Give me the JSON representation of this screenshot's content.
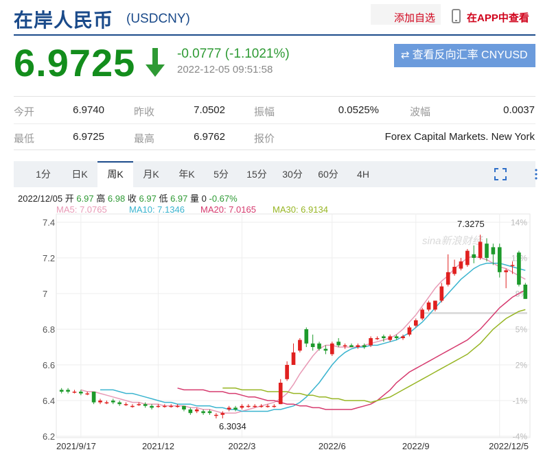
{
  "header": {
    "title": "在岸人民币",
    "code": "(USDCNY)",
    "add_favorite": "添加自选",
    "view_in_app": "在APP中查看"
  },
  "quote": {
    "price": "6.9725",
    "change": "-0.0777 (-1.1021%)",
    "timestamp": "2022-12-05 09:51:58",
    "direction": "down",
    "reverse_button": "查看反向汇率 CNYUSD"
  },
  "stats": [
    {
      "label": "今开",
      "value": "6.9740"
    },
    {
      "label": "昨收",
      "value": "7.0502"
    },
    {
      "label": "振幅",
      "value": "0.0525%"
    },
    {
      "label": "波幅",
      "value": "0.0037"
    },
    {
      "label": "最低",
      "value": "6.9725"
    },
    {
      "label": "最高",
      "value": "6.9762"
    },
    {
      "label": "报价",
      "value": "Forex Capital Markets. New York"
    }
  ],
  "tabs": [
    "1分",
    "日K",
    "周K",
    "月K",
    "年K",
    "5分",
    "15分",
    "30分",
    "60分",
    "4H"
  ],
  "active_tab": "周K",
  "bar_info": {
    "date": "2022/12/05",
    "open_label": "开",
    "open": "6.97",
    "high_label": "高",
    "high": "6.98",
    "close_label": "收",
    "close": "6.97",
    "low_label": "低",
    "low": "6.97",
    "volume_label": "量",
    "volume": "0",
    "change": "-0.67%"
  },
  "ma_legend": [
    {
      "text": "MA5: 7.0765",
      "color": "#e89ab6"
    },
    {
      "text": "MA10: 7.1346",
      "color": "#3ab4cf"
    },
    {
      "text": "MA20: 7.0165",
      "color": "#d63a6e"
    },
    {
      "text": "MA30: 6.9134",
      "color": "#97b523"
    }
  ],
  "chart_data": {
    "type": "candlestick",
    "ylim": [
      6.2,
      7.4
    ],
    "y_ticks": [
      "7.4",
      "7.2",
      "7",
      "6.8",
      "6.6",
      "6.4",
      "6.2"
    ],
    "right_ticks": [
      "14%",
      "11%",
      "8%",
      "5%",
      "2%",
      "-1%",
      "-4%"
    ],
    "x_labels": [
      "2021/9/17",
      "2021/12",
      "2022/3",
      "2022/6",
      "2022/9",
      "2022/12/5"
    ],
    "annotations": [
      {
        "text": "7.3275",
        "kind": "max"
      },
      {
        "text": "6.3034",
        "kind": "min"
      }
    ],
    "watermark": "sina新浪财经",
    "up_color": "#e0201f",
    "down_color": "#1d9a2b",
    "candles_ohlc": [
      [
        6.46,
        6.47,
        6.44,
        6.45
      ],
      [
        6.46,
        6.47,
        6.44,
        6.45
      ],
      [
        6.45,
        6.46,
        6.44,
        6.45
      ],
      [
        6.45,
        6.46,
        6.43,
        6.44
      ],
      [
        6.44,
        6.45,
        6.43,
        6.44
      ],
      [
        6.45,
        6.45,
        6.38,
        6.39
      ],
      [
        6.39,
        6.41,
        6.38,
        6.4
      ],
      [
        6.39,
        6.4,
        6.38,
        6.39
      ],
      [
        6.4,
        6.41,
        6.38,
        6.39
      ],
      [
        6.39,
        6.4,
        6.37,
        6.38
      ],
      [
        6.38,
        6.39,
        6.37,
        6.38
      ],
      [
        6.37,
        6.38,
        6.36,
        6.37
      ],
      [
        6.38,
        6.39,
        6.37,
        6.38
      ],
      [
        6.38,
        6.39,
        6.36,
        6.37
      ],
      [
        6.37,
        6.38,
        6.35,
        6.36
      ],
      [
        6.37,
        6.38,
        6.36,
        6.37
      ],
      [
        6.37,
        6.38,
        6.36,
        6.37
      ],
      [
        6.37,
        6.38,
        6.36,
        6.37
      ],
      [
        6.37,
        6.38,
        6.36,
        6.37
      ],
      [
        6.37,
        6.37,
        6.34,
        6.35
      ],
      [
        6.35,
        6.36,
        6.32,
        6.33
      ],
      [
        6.34,
        6.36,
        6.33,
        6.35
      ],
      [
        6.34,
        6.35,
        6.32,
        6.33
      ],
      [
        6.34,
        6.35,
        6.32,
        6.33
      ],
      [
        6.32,
        6.33,
        6.3,
        6.32
      ],
      [
        6.32,
        6.34,
        6.3,
        6.33
      ],
      [
        6.35,
        6.37,
        6.34,
        6.36
      ],
      [
        6.36,
        6.37,
        6.34,
        6.35
      ],
      [
        6.36,
        6.38,
        6.35,
        6.37
      ],
      [
        6.37,
        6.38,
        6.36,
        6.37
      ],
      [
        6.37,
        6.38,
        6.36,
        6.37
      ],
      [
        6.37,
        6.38,
        6.36,
        6.37
      ],
      [
        6.37,
        6.38,
        6.36,
        6.37
      ],
      [
        6.37,
        6.38,
        6.36,
        6.37
      ],
      [
        6.38,
        6.52,
        6.38,
        6.5
      ],
      [
        6.52,
        6.62,
        6.51,
        6.6
      ],
      [
        6.6,
        6.72,
        6.6,
        6.67
      ],
      [
        6.68,
        6.75,
        6.67,
        6.74
      ],
      [
        6.8,
        6.81,
        6.7,
        6.72
      ],
      [
        6.72,
        6.77,
        6.68,
        6.7
      ],
      [
        6.72,
        6.73,
        6.68,
        6.69
      ],
      [
        6.69,
        6.71,
        6.66,
        6.68
      ],
      [
        6.66,
        6.73,
        6.65,
        6.72
      ],
      [
        6.73,
        6.75,
        6.7,
        6.71
      ],
      [
        6.71,
        6.72,
        6.69,
        6.71
      ],
      [
        6.71,
        6.72,
        6.7,
        6.7
      ],
      [
        6.7,
        6.72,
        6.69,
        6.71
      ],
      [
        6.71,
        6.72,
        6.69,
        6.7
      ],
      [
        6.71,
        6.76,
        6.7,
        6.75
      ],
      [
        6.75,
        6.76,
        6.74,
        6.75
      ],
      [
        6.76,
        6.77,
        6.73,
        6.75
      ],
      [
        6.74,
        6.77,
        6.73,
        6.76
      ],
      [
        6.76,
        6.77,
        6.74,
        6.75
      ],
      [
        6.75,
        6.77,
        6.74,
        6.76
      ],
      [
        6.77,
        6.82,
        6.76,
        6.81
      ],
      [
        6.82,
        6.86,
        6.81,
        6.85
      ],
      [
        6.86,
        6.92,
        6.85,
        6.91
      ],
      [
        6.91,
        6.96,
        6.9,
        6.95
      ],
      [
        6.91,
        6.96,
        6.9,
        6.96
      ],
      [
        6.96,
        7.06,
        6.95,
        7.04
      ],
      [
        7.05,
        7.22,
        7.04,
        7.12
      ],
      [
        7.11,
        7.19,
        7.1,
        7.15
      ],
      [
        7.14,
        7.2,
        7.13,
        7.18
      ],
      [
        7.16,
        7.25,
        7.15,
        7.24
      ],
      [
        7.22,
        7.27,
        7.17,
        7.2
      ],
      [
        7.2,
        7.33,
        7.19,
        7.29
      ],
      [
        7.28,
        7.31,
        7.18,
        7.2
      ],
      [
        7.26,
        7.28,
        7.16,
        7.22
      ],
      [
        7.26,
        7.28,
        7.09,
        7.12
      ],
      [
        7.12,
        7.14,
        7.03,
        7.13
      ],
      [
        7.16,
        7.18,
        7.11,
        7.16
      ],
      [
        7.23,
        7.24,
        7.04,
        7.05
      ],
      [
        7.05,
        7.06,
        6.97,
        6.97
      ]
    ],
    "series": [
      {
        "name": "MA5",
        "values": [
          6.46,
          6.45,
          6.45,
          6.44,
          6.43,
          6.42,
          6.41,
          6.4,
          6.39,
          6.39,
          6.38,
          6.38,
          6.38,
          6.37,
          6.37,
          6.37,
          6.37,
          6.36,
          6.36,
          6.35,
          6.35,
          6.34,
          6.33,
          6.33,
          6.33,
          6.34,
          6.35,
          6.36,
          6.37,
          6.38,
          6.39,
          6.41,
          6.44,
          6.49,
          6.55,
          6.6,
          6.65,
          6.69,
          6.71,
          6.71,
          6.7,
          6.7,
          6.7,
          6.7,
          6.71,
          6.72,
          6.73,
          6.74,
          6.75,
          6.77,
          6.8,
          6.84,
          6.88,
          6.93,
          6.98,
          7.03,
          7.07,
          7.1,
          7.14,
          7.17,
          7.2,
          7.21,
          7.2,
          7.19,
          7.17,
          7.15,
          7.14,
          7.12,
          7.1,
          7.08
        ]
      },
      {
        "name": "MA10",
        "values": [
          6.46,
          6.46,
          6.46,
          6.45,
          6.44,
          6.44,
          6.43,
          6.42,
          6.41,
          6.4,
          6.39,
          6.39,
          6.38,
          6.38,
          6.38,
          6.37,
          6.37,
          6.37,
          6.36,
          6.36,
          6.35,
          6.35,
          6.34,
          6.34,
          6.34,
          6.34,
          6.34,
          6.35,
          6.35,
          6.36,
          6.37,
          6.39,
          6.42,
          6.46,
          6.5,
          6.55,
          6.6,
          6.64,
          6.67,
          6.69,
          6.7,
          6.7,
          6.71,
          6.71,
          6.72,
          6.73,
          6.74,
          6.76,
          6.78,
          6.81,
          6.84,
          6.88,
          6.92,
          6.96,
          7.0,
          7.04,
          7.08,
          7.11,
          7.14,
          7.16,
          7.17,
          7.17,
          7.17,
          7.16,
          7.15,
          7.14,
          7.13
        ]
      },
      {
        "name": "MA20",
        "values": [
          6.47,
          6.46,
          6.46,
          6.46,
          6.46,
          6.45,
          6.45,
          6.45,
          6.44,
          6.44,
          6.43,
          6.42,
          6.42,
          6.41,
          6.4,
          6.4,
          6.39,
          6.38,
          6.38,
          6.37,
          6.37,
          6.36,
          6.36,
          6.35,
          6.35,
          6.35,
          6.35,
          6.35,
          6.36,
          6.37,
          6.38,
          6.4,
          6.43,
          6.46,
          6.5,
          6.53,
          6.56,
          6.58,
          6.6,
          6.62,
          6.64,
          6.66,
          6.68,
          6.7,
          6.72,
          6.74,
          6.77,
          6.8,
          6.84,
          6.88,
          6.92,
          6.95,
          6.98,
          7.0,
          7.02
        ]
      },
      {
        "name": "MA30",
        "values": [
          6.47,
          6.47,
          6.47,
          6.46,
          6.46,
          6.46,
          6.46,
          6.45,
          6.45,
          6.45,
          6.45,
          6.44,
          6.44,
          6.43,
          6.43,
          6.42,
          6.42,
          6.41,
          6.41,
          6.4,
          6.4,
          6.4,
          6.4,
          6.39,
          6.4,
          6.41,
          6.42,
          6.44,
          6.46,
          6.48,
          6.5,
          6.52,
          6.54,
          6.56,
          6.58,
          6.6,
          6.62,
          6.64,
          6.66,
          6.69,
          6.72,
          6.76,
          6.8,
          6.83,
          6.86,
          6.88,
          6.9,
          6.91
        ]
      }
    ]
  }
}
